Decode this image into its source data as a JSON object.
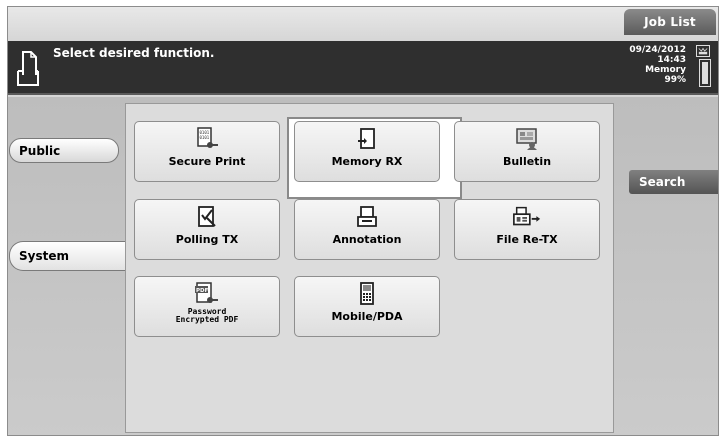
{
  "header": {
    "job_list_label": "Job List",
    "message": "Select desired function.",
    "date": "09/24/2012",
    "time": "14:43",
    "memory_label": "Memory",
    "memory_percent": "99%"
  },
  "tabs": {
    "public_label": "Public",
    "system_label": "System"
  },
  "functions": [
    {
      "label": "Secure Print"
    },
    {
      "label": "Memory RX"
    },
    {
      "label": "Bulletin"
    },
    {
      "label": "Polling TX"
    },
    {
      "label": "Annotation"
    },
    {
      "label": "File Re-TX"
    },
    {
      "label_line1": "Password",
      "label_line2": "Encrypted PDF"
    },
    {
      "label": "Mobile/PDA"
    }
  ],
  "search_label": "Search",
  "selected_function": "Memory RX",
  "icons": {
    "document": "document-icon",
    "toner": "toner-icon",
    "memory_gauge": "memory-gauge-icon"
  },
  "colors": {
    "message_bar": "#2f2f2f",
    "tab_dark": "#5b5b5b"
  },
  "memory_fill_fraction": 0.99
}
